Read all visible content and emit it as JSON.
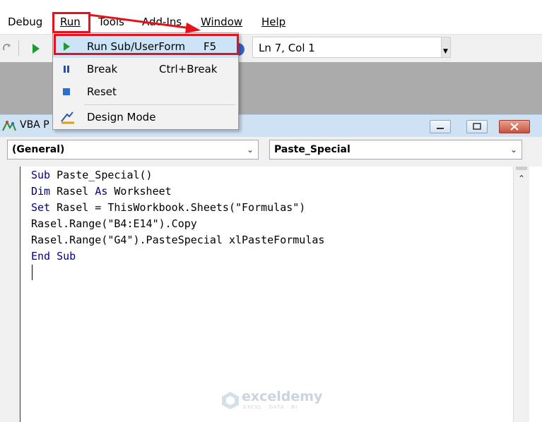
{
  "menu": {
    "debug": "Debug",
    "run": "Run",
    "tools": "Tools",
    "addins": "Add-Ins",
    "window": "Window",
    "help": "Help"
  },
  "toolbar": {
    "status": "Ln 7, Col 1"
  },
  "run_menu": {
    "items": [
      {
        "label": "Run Sub/UserForm",
        "shortcut": "F5",
        "icon": "play-icon"
      },
      {
        "label": "Break",
        "shortcut": "Ctrl+Break",
        "icon": "pause-icon"
      },
      {
        "label": "Reset",
        "shortcut": "",
        "icon": "stop-icon"
      },
      {
        "label": "Design Mode",
        "shortcut": "",
        "icon": "design-mode-icon"
      }
    ]
  },
  "vba_window": {
    "title": "VBA P"
  },
  "combos": {
    "object": "(General)",
    "procedure": "Paste_Special"
  },
  "code": {
    "line1_kw": "Sub",
    "line1_rest": " Paste_Special()",
    "line2_kw": "Dim",
    "line2_mid": " Rasel ",
    "line2_kw2": "As",
    "line2_rest": " Worksheet",
    "line3_kw": "Set",
    "line3_rest": " Rasel = ThisWorkbook.Sheets(\"Formulas\")",
    "line4": "Rasel.Range(\"B4:E14\").Copy",
    "line5": "Rasel.Range(\"G4\").PasteSpecial xlPasteFormulas",
    "line6_kw": "End Sub"
  },
  "watermark": {
    "brand": "exceldemy",
    "tagline": "EXCEL · DATA · BI"
  },
  "colors": {
    "highlight_red": "#e8101a",
    "keyword_blue": "#00008b",
    "menu_highlight": "#cce4f7"
  }
}
